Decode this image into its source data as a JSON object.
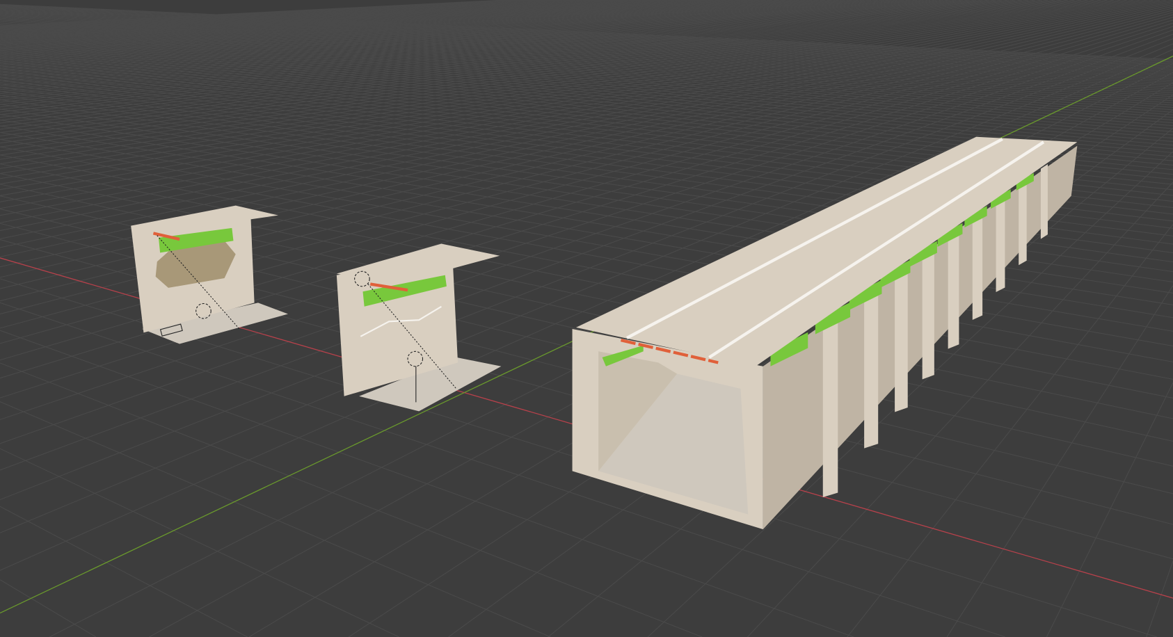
{
  "viewport": {
    "mode": "3d-viewport",
    "colors": {
      "background": "#3d3d3d",
      "grid": "#4a4a4a",
      "x_axis": "#b8414b",
      "y_axis": "#6a9a2c",
      "wall": "#d9cfc0",
      "wall_shade": "#bfb4a4",
      "floor": "#cfc8bd",
      "accent_green": "#78c83c",
      "accent_orange": "#e0603a",
      "stripe": "#f6f3ee"
    }
  }
}
